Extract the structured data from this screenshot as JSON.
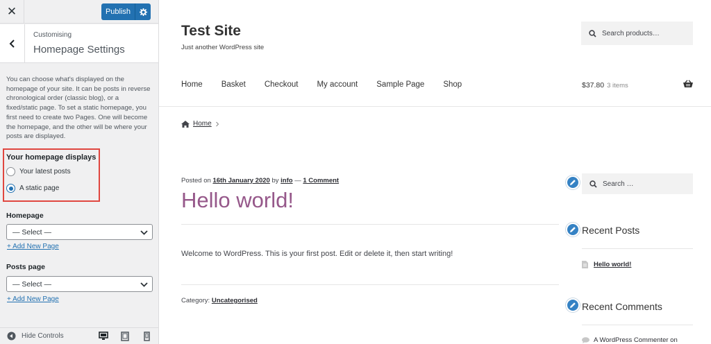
{
  "panel": {
    "close_glyph": "✕",
    "publish_label": "Publish",
    "breadcrumb": "Customising",
    "section_title": "Homepage Settings",
    "description": "You can choose what's displayed on the homepage of your site. It can be posts in reverse chronological order (classic blog), or a fixed/static page. To set a static homepage, you first need to create two Pages. One will become the homepage, and the other will be where your posts are displayed.",
    "homepage_displays": {
      "label": "Your homepage displays",
      "options": [
        "Your latest posts",
        "A static page"
      ],
      "selected": "A static page"
    },
    "homepage": {
      "label": "Homepage",
      "value": "— Select —",
      "add_link": "+ Add New Page"
    },
    "posts_page": {
      "label": "Posts page",
      "value": "— Select —",
      "add_link": "+ Add New Page"
    },
    "footer": {
      "hide_controls": "Hide Controls"
    }
  },
  "preview": {
    "site_title": "Test Site",
    "site_description": "Just another WordPress site",
    "search_placeholder": "Search products…",
    "nav": [
      "Home",
      "Basket",
      "Checkout",
      "My account",
      "Sample Page",
      "Shop"
    ],
    "cart_total": "$37.80",
    "cart_items": "3 items",
    "breadcrumb_home": "Home",
    "post": {
      "posted_on": "Posted on",
      "date": "16th January 2020",
      "by": "by",
      "author": "info",
      "dash": "—",
      "comments": "1 Comment",
      "title": "Hello world!",
      "body": "Welcome to WordPress. This is your first post. Edit or delete it, then start writing!",
      "category_label": "Category:",
      "category": "Uncategorised"
    },
    "sidebar": {
      "search_placeholder": "Search …",
      "recent_posts_title": "Recent Posts",
      "recent_post": "Hello world!",
      "recent_comments_title": "Recent Comments",
      "recent_comment": "A WordPress Commenter on"
    }
  },
  "colors": {
    "accent": "#2271b1",
    "highlight_box": "#e0463f",
    "post_title": "#96588a",
    "edit_pencil": "#3582c4"
  }
}
